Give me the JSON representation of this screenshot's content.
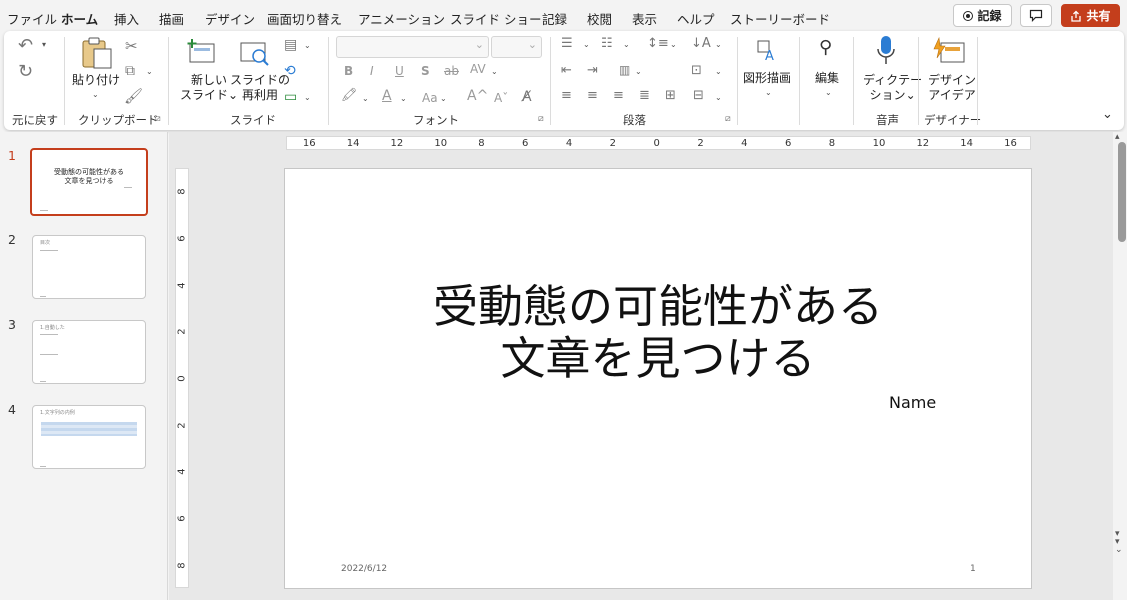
{
  "menu": {
    "items": [
      "ファイル",
      "ホーム",
      "挿入",
      "描画",
      "デザイン",
      "画面切り替え",
      "アニメーション",
      "スライド ショー",
      "記録",
      "校閲",
      "表示",
      "ヘルプ",
      "ストーリーボード"
    ],
    "active": "ホーム",
    "record_label": "記録",
    "share_label": "共有"
  },
  "ribbon": {
    "undo": {
      "group": "元に戻す"
    },
    "clipboard": {
      "group": "クリップボード",
      "paste": "貼り付け"
    },
    "slides": {
      "group": "スライド",
      "new_slide_1": "新しい",
      "new_slide_2": "スライド",
      "reuse_1": "スライドの",
      "reuse_2": "再利用"
    },
    "font": {
      "group": "フォント",
      "bold": "B",
      "italic": "I",
      "underline": "U",
      "shadow": "S",
      "strike": "ab",
      "spacing": "AV",
      "grow": "A",
      "shrink": "A",
      "case": "Aa"
    },
    "paragraph": {
      "group": "段落"
    },
    "drawing": {
      "label": "図形描画"
    },
    "editing": {
      "label": "編集"
    },
    "voice": {
      "group": "音声",
      "dictate_1": "ディクテー",
      "dictate_2": "ション"
    },
    "designer": {
      "group": "デザイナー",
      "ideas_1": "デザイン",
      "ideas_2": "アイデア"
    }
  },
  "slides_pane": {
    "numbers": [
      "1",
      "2",
      "3",
      "4"
    ],
    "thumb1_title": "受動態の可能性がある 文章を見つける",
    "thumb2_title": "目次",
    "thumb3_title": "1.自動した",
    "thumb4_title": "1.文字列の内例"
  },
  "slide": {
    "title_line1": "受動態の可能性がある",
    "title_line2": "文章を見つける",
    "subtitle": "Name",
    "date": "2022/6/12",
    "page_number": "1"
  },
  "rulers": {
    "h_ticks": [
      "16",
      "14",
      "12",
      "10",
      "8",
      "6",
      "4",
      "2",
      "0",
      "2",
      "4",
      "6",
      "8",
      "10",
      "12",
      "14",
      "16"
    ],
    "v_ticks": [
      "8",
      "6",
      "4",
      "2",
      "0",
      "2",
      "4",
      "6",
      "8"
    ]
  },
  "colors": {
    "accent": "#c43e1c",
    "share_bg": "#c43e1c",
    "mic_blue": "#2b7cd3"
  }
}
